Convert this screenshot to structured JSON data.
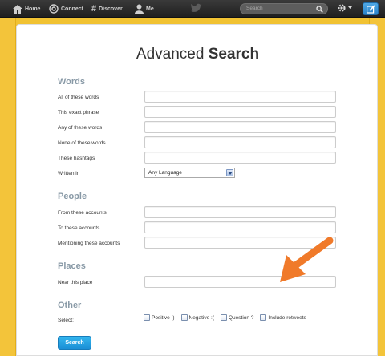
{
  "nav": {
    "home": "Home",
    "connect": "Connect",
    "discover": "Discover",
    "me": "Me",
    "search_placeholder": "Search"
  },
  "page": {
    "title_light": "Advanced",
    "title_bold": "Search"
  },
  "sections": {
    "words": {
      "heading": "Words",
      "all": "All of these words",
      "exact": "This exact phrase",
      "any": "Any of these words",
      "none": "None of these words",
      "hashtags": "These hashtags",
      "written_in": "Written in",
      "language_value": "Any Language"
    },
    "people": {
      "heading": "People",
      "from": "From these accounts",
      "to": "To these accounts",
      "mentioning": "Mentioning these accounts"
    },
    "places": {
      "heading": "Places",
      "near": "Near this place"
    },
    "other": {
      "heading": "Other",
      "select": "Select:",
      "positive": "Positive :)",
      "negative": "Negative :(",
      "question": "Question ?",
      "retweets": "Include retweets"
    }
  },
  "actions": {
    "search": "Search"
  },
  "colors": {
    "frame": "#f1c232",
    "button": "#1b8fd6",
    "annotation_arrow": "#f07a2a"
  },
  "icons": {
    "home": "home-icon",
    "connect": "at-icon",
    "discover": "hash-icon",
    "me": "person-icon",
    "bird": "bird-icon",
    "search": "magnifier-icon",
    "settings": "gear-icon",
    "compose": "compose-icon"
  }
}
